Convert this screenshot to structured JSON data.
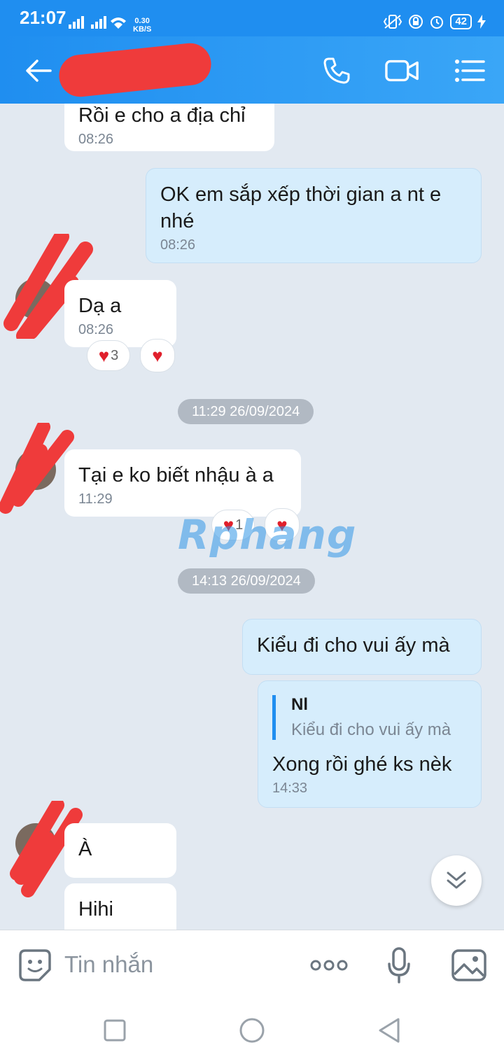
{
  "status_bar": {
    "time": "21:07",
    "net_speed_value": "0.30",
    "net_speed_unit": "KB/S",
    "battery": "42"
  },
  "header": {
    "contact_name": ""
  },
  "messages": {
    "m1": {
      "text": "Rồi e cho a địa chỉ",
      "time": "08:26"
    },
    "m2": {
      "text": "OK em sắp xếp thời gian a nt e nhé",
      "time": "08:26"
    },
    "m3": {
      "text": "Dạ a",
      "time": "08:26",
      "reaction_count": "3"
    },
    "date1": "11:29 26/09/2024",
    "m4": {
      "text": "Tại e ko biết nhậu à a",
      "time": "11:29",
      "reaction_count": "1"
    },
    "date2": "14:13 26/09/2024",
    "m5": {
      "text": "Kiểu đi cho vui ấy mà"
    },
    "m6": {
      "quote_name": "Nl",
      "quote_text": "Kiểu đi cho vui ấy mà",
      "text": "Xong rồi ghé ks nèk",
      "time": "14:33"
    },
    "m7": {
      "text": "À"
    },
    "m8": {
      "text": "Hihi"
    }
  },
  "watermark": "Rphang",
  "input": {
    "placeholder": "Tin nhắn"
  },
  "colors": {
    "header": "#1f8ef0",
    "outgoing_bubble": "#d6edfc",
    "incoming_bubble": "#ffffff",
    "chat_background": "#e2e9f1",
    "redaction": "#ef3b3b"
  }
}
